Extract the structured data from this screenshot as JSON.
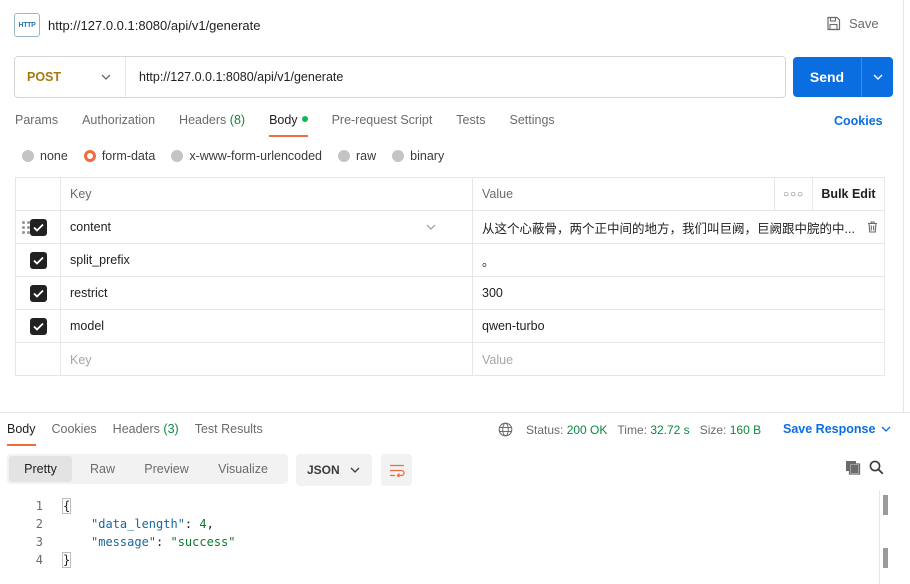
{
  "header": {
    "http_badge": "HTTP",
    "title": "http://127.0.0.1:8080/api/v1/generate",
    "save_label": "Save"
  },
  "request": {
    "method": "POST",
    "url": "http://127.0.0.1:8080/api/v1/generate",
    "send_label": "Send"
  },
  "request_tabs": {
    "params": "Params",
    "authorization": "Authorization",
    "headers": "Headers",
    "headers_count": "(8)",
    "body": "Body",
    "prerequest": "Pre-request Script",
    "tests": "Tests",
    "settings": "Settings",
    "cookies": "Cookies"
  },
  "body_modes": {
    "none": "none",
    "form_data": "form-data",
    "urlencoded": "x-www-form-urlencoded",
    "raw": "raw",
    "binary": "binary",
    "selected": "form-data"
  },
  "table": {
    "key_header": "Key",
    "value_header": "Value",
    "bulk_edit": "Bulk Edit",
    "rows": [
      {
        "key": "content",
        "value": "从这个心蔽骨，两个正中间的地方，我们叫巨阙，巨阙跟中脘的中...",
        "checked": true
      },
      {
        "key": "split_prefix",
        "value": "。",
        "checked": true
      },
      {
        "key": "restrict",
        "value": "300",
        "checked": true
      },
      {
        "key": "model",
        "value": "qwen-turbo",
        "checked": true
      }
    ],
    "new_key_placeholder": "Key",
    "new_value_placeholder": "Value"
  },
  "response_tabs": {
    "body": "Body",
    "cookies": "Cookies",
    "headers": "Headers",
    "headers_count": "(3)",
    "test_results": "Test Results"
  },
  "response_status": {
    "status_label": "Status:",
    "status_value": "200 OK",
    "time_label": "Time:",
    "time_value": "32.72 s",
    "size_label": "Size:",
    "size_value": "160 B",
    "save_response": "Save Response"
  },
  "response_view": {
    "pretty": "Pretty",
    "raw": "Raw",
    "preview": "Preview",
    "visualize": "Visualize",
    "format": "JSON"
  },
  "response_body": {
    "line_numbers": [
      "1",
      "2",
      "3",
      "4"
    ],
    "open_brace": "{",
    "close_brace": "}",
    "fields": [
      {
        "key": "\"data_length\"",
        "value": "4",
        "sep": ",",
        "type": "number"
      },
      {
        "key": "\"message\"",
        "value": "\"success\"",
        "sep": "",
        "type": "string"
      }
    ]
  },
  "colors": {
    "accent_orange": "#f26b3a",
    "primary_blue": "#0b6ee0",
    "status_green": "#0a8a3e",
    "method_post": "#a8780a"
  }
}
